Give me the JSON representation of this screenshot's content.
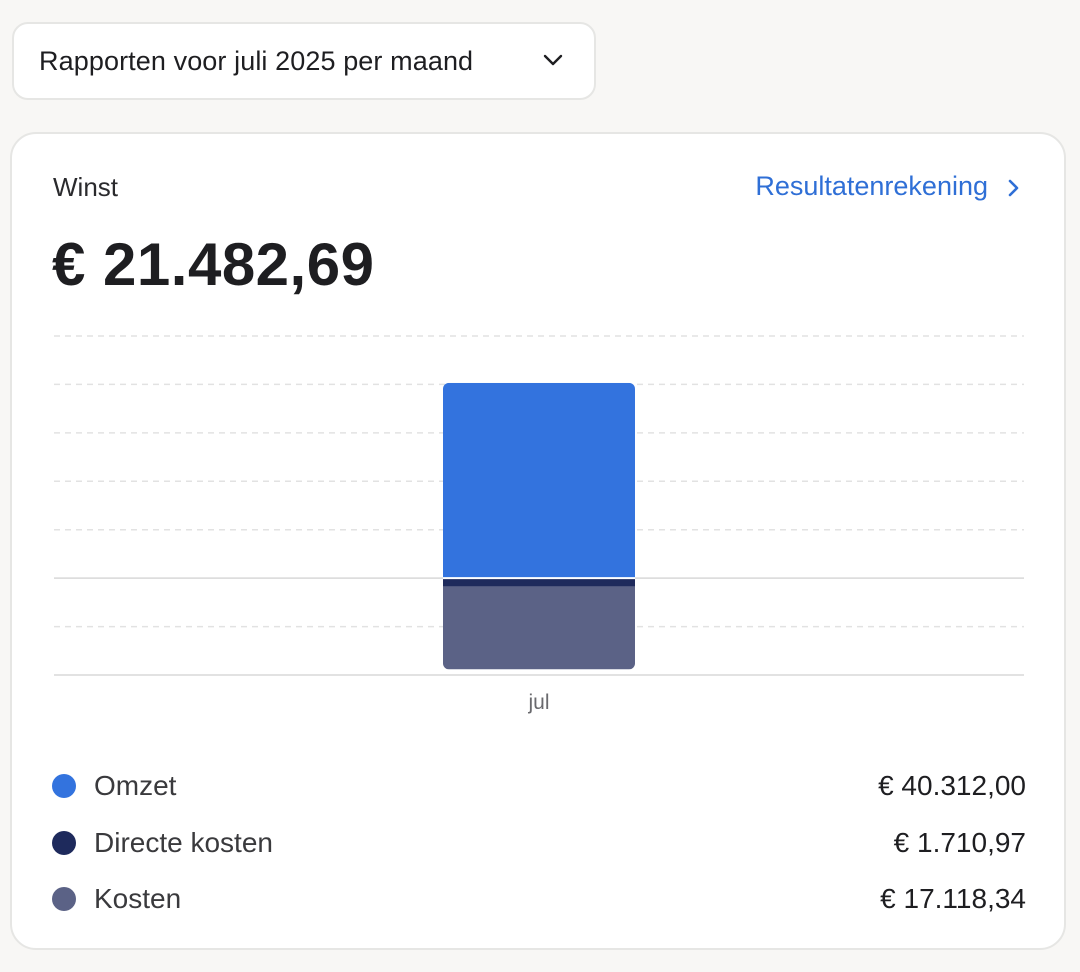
{
  "period_select": {
    "label": "Rapporten voor juli 2025 per maand"
  },
  "card": {
    "title": "Winst",
    "link_label": "Resultatenrekening",
    "amount": "€ 21.482,69"
  },
  "chart_data": {
    "type": "bar",
    "stacked": true,
    "categories": [
      "jul"
    ],
    "series": [
      {
        "name": "Omzet",
        "values": [
          40312.0
        ],
        "color": "#3373de",
        "direction": "positive"
      },
      {
        "name": "Directe kosten",
        "values": [
          -1710.97
        ],
        "color": "#1e2a5c",
        "direction": "negative"
      },
      {
        "name": "Kosten",
        "values": [
          -17118.34
        ],
        "color": "#5b6286",
        "direction": "negative"
      }
    ],
    "ylim": [
      -20000,
      50000
    ],
    "grid": true,
    "legend": "bottom",
    "title": "",
    "xlabel": "",
    "ylabel": ""
  },
  "legend": [
    {
      "name": "Omzet",
      "value": "€ 40.312,00",
      "color": "#3373de"
    },
    {
      "name": "Directe kosten",
      "value": "€ 1.710,97",
      "color": "#1e2a5c"
    },
    {
      "name": "Kosten",
      "value": "€ 17.118,34",
      "color": "#5b6286"
    }
  ]
}
